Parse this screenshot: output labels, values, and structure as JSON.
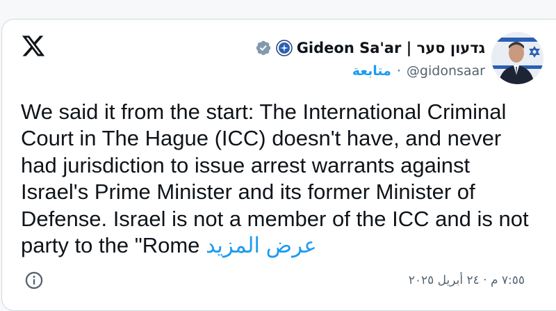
{
  "author": {
    "display_name": "Gideon Sa'ar | גדעון סער",
    "handle": "@gidonsaar",
    "follow_label": "متابعة",
    "separator": "·"
  },
  "tweet": {
    "text": "We said it from the start: The International Criminal Court in The Hague (ICC) doesn't have, and never had jurisdiction to issue arrest warrants against Israel's Prime Minister and its former Minister of Defense. Israel is not a member of the ICC and is not party to the \"Rome",
    "show_more_label": "عرض المزيد"
  },
  "meta": {
    "timestamp": "٧:٥٥ م · ٢٤ أبريل ٢٠٢٥"
  },
  "icons": {
    "platform": "x-logo",
    "verified": "gray-verified-badge",
    "affiliate": "government-seal-icon",
    "info": "info-icon"
  },
  "colors": {
    "accent": "#1d9bf0",
    "text": "#0f1419",
    "secondary_text": "#536471",
    "border": "#cfd9de"
  }
}
